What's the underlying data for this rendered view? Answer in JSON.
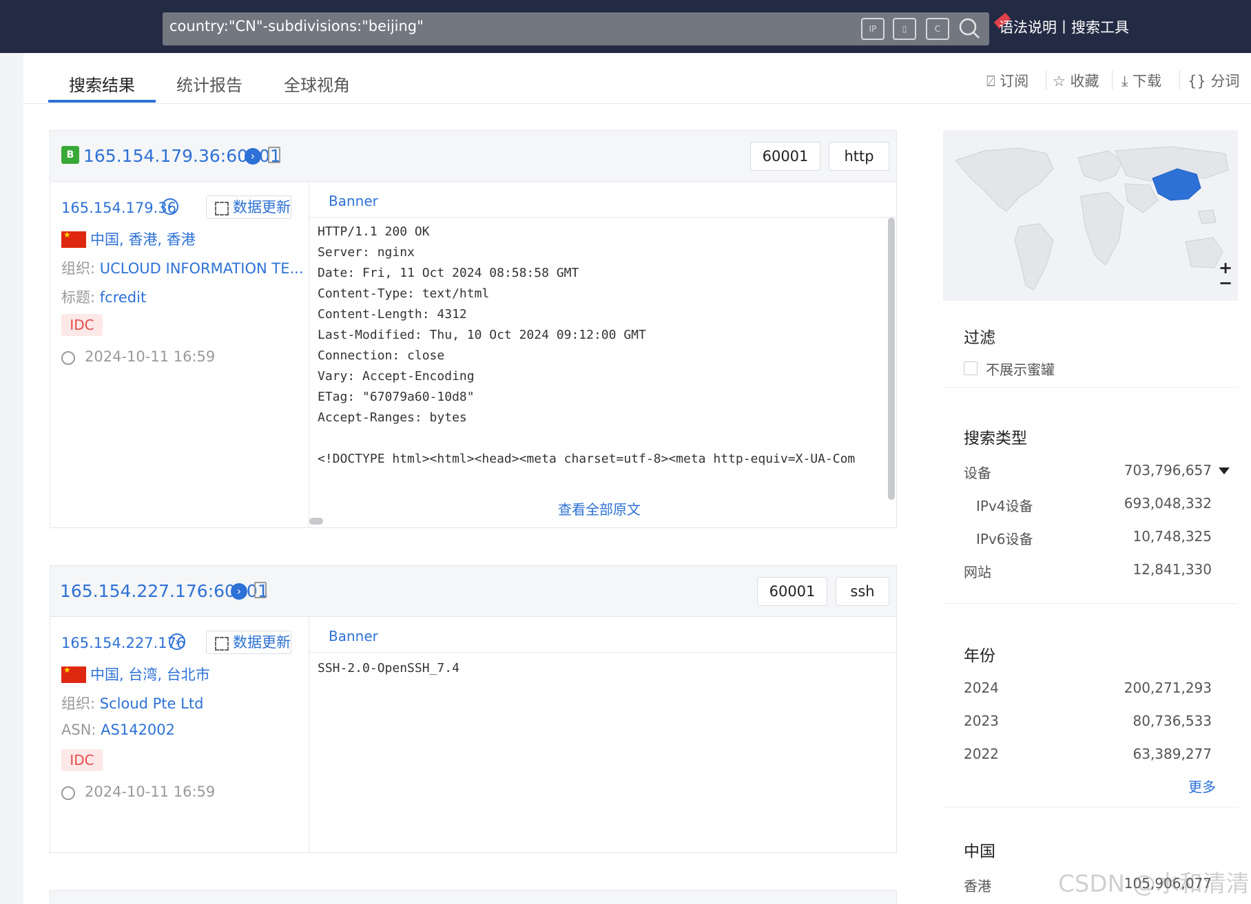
{
  "search": {
    "query": "country:\"CN\"-subdivisions:\"beijing\"",
    "icon_ip": "IP",
    "tools": "语法说明丨搜索工具"
  },
  "tabs": [
    "搜索结果",
    "统计报告",
    "全球视角"
  ],
  "actions": [
    "订阅",
    "收藏",
    "下载",
    "分词"
  ],
  "results": [
    {
      "title": "165.154.179.36:60001",
      "port": "60001",
      "protocol": "http",
      "ip": "165.154.179.36",
      "update_label": "数据更新",
      "location": "中国, 香港, 香港",
      "field1_label": "组织: ",
      "field1_value": "UCLOUD INFORMATION TE...",
      "field2_label": "标题: ",
      "field2_value": "fcredit",
      "tag": "IDC",
      "time": "2024-10-11 16:59",
      "banner_label": "Banner",
      "banner": "HTTP/1.1 200 OK\nServer: nginx\nDate: Fri, 11 Oct 2024 08:58:58 GMT\nContent-Type: text/html\nContent-Length: 4312\nLast-Modified: Thu, 10 Oct 2024 09:12:00 GMT\nConnection: close\nVary: Accept-Encoding\nETag: \"67079a60-10d8\"\nAccept-Ranges: bytes\n\n<!DOCTYPE html><html><head><meta charset=utf-8><meta http-equiv=X-UA-Com",
      "view_all": "查看全部原文"
    },
    {
      "title": "165.154.227.176:60001",
      "port": "60001",
      "protocol": "ssh",
      "ip": "165.154.227.176",
      "update_label": "数据更新",
      "location": "中国, 台湾, 台北市",
      "field1_label": "组织: ",
      "field1_value": "Scloud Pte Ltd",
      "field2_label": "ASN: ",
      "field2_value": "AS142002",
      "tag": "IDC",
      "time": "2024-10-11 16:59",
      "banner_label": "Banner",
      "banner": "SSH-2.0-OpenSSH_7.4"
    }
  ],
  "sidebar": {
    "zoom_in": "+",
    "zoom_out": "−",
    "filter": {
      "title": "过滤",
      "checkbox_label": "不展示蜜罐"
    },
    "search_type": {
      "title": "搜索类型",
      "rows": [
        {
          "label": "设备",
          "value": "703,796,657"
        },
        {
          "label": "IPv4设备",
          "value": "693,048,332"
        },
        {
          "label": "IPv6设备",
          "value": "10,748,325"
        },
        {
          "label": "网站",
          "value": "12,841,330"
        }
      ]
    },
    "year": {
      "title": "年份",
      "rows": [
        {
          "label": "2024",
          "value": "200,271,293"
        },
        {
          "label": "2023",
          "value": "80,736,533"
        },
        {
          "label": "2022",
          "value": "63,389,277"
        }
      ],
      "more": "更多"
    },
    "country": {
      "title": "中国",
      "rows": [
        {
          "label": "香港",
          "value": "105,906,077"
        }
      ]
    }
  },
  "watermark": "CSDN @水和清清",
  "colors": {
    "topbar": "#232b44",
    "accent": "#2d71d6",
    "tag_bg": "#fde8e8",
    "tag_text": "#e54b4b",
    "map_highlight": "#2d71d6"
  }
}
